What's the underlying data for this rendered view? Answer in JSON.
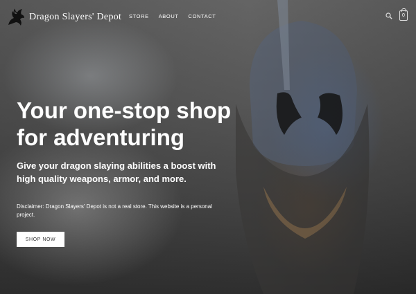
{
  "brand": {
    "name": "Dragon Slayers' Depot"
  },
  "nav": {
    "items": [
      "STORE",
      "ABOUT",
      "CONTACT"
    ]
  },
  "header_icons": {
    "search": "search-icon",
    "cart": "shopping-bag-icon",
    "cart_count": "0"
  },
  "hero": {
    "headline": "Your one-stop shop for adventuring",
    "subhead": "Give your dragon slaying abilities a boost with high quality weapons, armor, and more.",
    "disclaimer": "Disclaimer: Dragon Slayers' Depot is not a real store. This website is a personal project.",
    "cta_label": "SHOP NOW"
  },
  "colors": {
    "text": "#ffffff",
    "button_bg": "#ffffff",
    "button_text": "#333333"
  }
}
